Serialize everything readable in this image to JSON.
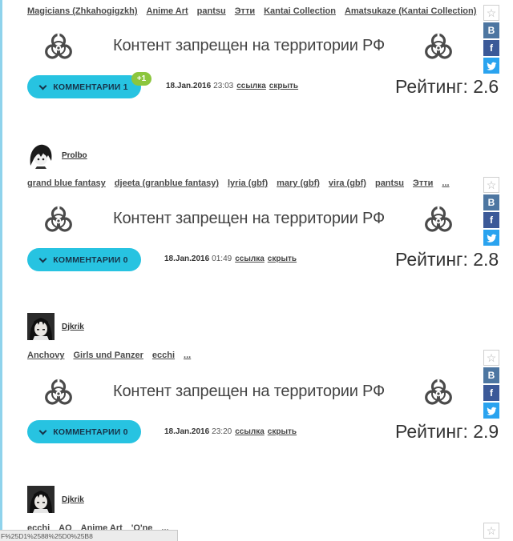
{
  "posts": [
    {
      "tags": [
        "Magicians (Zhkahogigzkh)",
        "Anime Art",
        "pantsu",
        "Этти",
        "Kantai Collection",
        "Amatsukaze (Kantai Collection)",
        "..."
      ],
      "banner_text": "Контент запрещен на территории РФ",
      "comments_label": "КОММЕНТАРИИ 1",
      "comments_badge": "+1",
      "date": "18.Jan.2016",
      "time": "23:03",
      "link_label": "ссылка",
      "hide_label": "скрыть",
      "rating": "Рейтинг: 2.6"
    },
    {
      "author": "Prolbo",
      "tags": [
        "grand blue fantasy",
        "djeeta (granblue fantasy)",
        "lyria (gbf)",
        "mary (gbf)",
        "vira (gbf)",
        "pantsu",
        "Этти",
        "..."
      ],
      "banner_text": "Контент запрещен на территории РФ",
      "comments_label": "КОММЕНТАРИИ 0",
      "date": "18.Jan.2016",
      "time": "01:49",
      "link_label": "ссылка",
      "hide_label": "скрыть",
      "rating": "Рейтинг: 2.8"
    },
    {
      "author": "Djkrik",
      "tags": [
        "Anchovy",
        "Girls und Panzer",
        "ecchi",
        "..."
      ],
      "banner_text": "Контент запрещен на территории РФ",
      "comments_label": "КОММЕНТАРИИ 0",
      "date": "18.Jan.2016",
      "time": "23:20",
      "link_label": "ссылка",
      "hide_label": "скрыть",
      "rating": "Рейтинг: 2.9"
    },
    {
      "author": "Djkrik",
      "tags": [
        "ecchi",
        "AO",
        "Anime Art",
        "'O'ne",
        "..."
      ]
    }
  ],
  "share": {
    "star": "☆",
    "vk": "B",
    "fb": "f"
  },
  "status_bar": "F%25D1%2588%25D0%25B8",
  "colors": {
    "accent": "#27c3e1",
    "badge": "#8cc63e",
    "vk": "#4d76a1",
    "fb": "#3b5998",
    "tw": "#2aa3ef"
  }
}
